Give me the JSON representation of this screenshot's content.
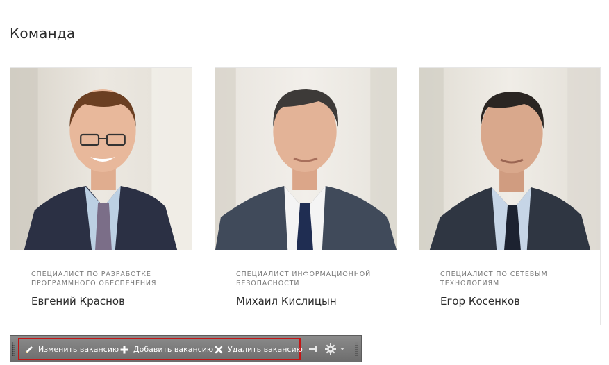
{
  "page": {
    "title": "Команда"
  },
  "team": [
    {
      "position": "Специалист по разработке программного обеспечения",
      "name": "Евгений Краснов"
    },
    {
      "position": "Специалист информационной безопасности",
      "name": "Михаил Кислицын"
    },
    {
      "position": "Специалист по сетевым технологиям",
      "name": "Егор Косенков"
    }
  ],
  "toolbar": {
    "edit_label": "Изменить вакансию",
    "add_label": "Добавить вакансию",
    "delete_label": "Удалить вакансию",
    "icons": [
      "pencil-icon",
      "plus-icon",
      "close-icon",
      "pin-icon",
      "gear-icon",
      "chevron-down-icon"
    ]
  },
  "colors": {
    "toolbar_bg": "#7a7a7a",
    "highlight": "#c41414",
    "card_border": "#e6e6e6"
  }
}
